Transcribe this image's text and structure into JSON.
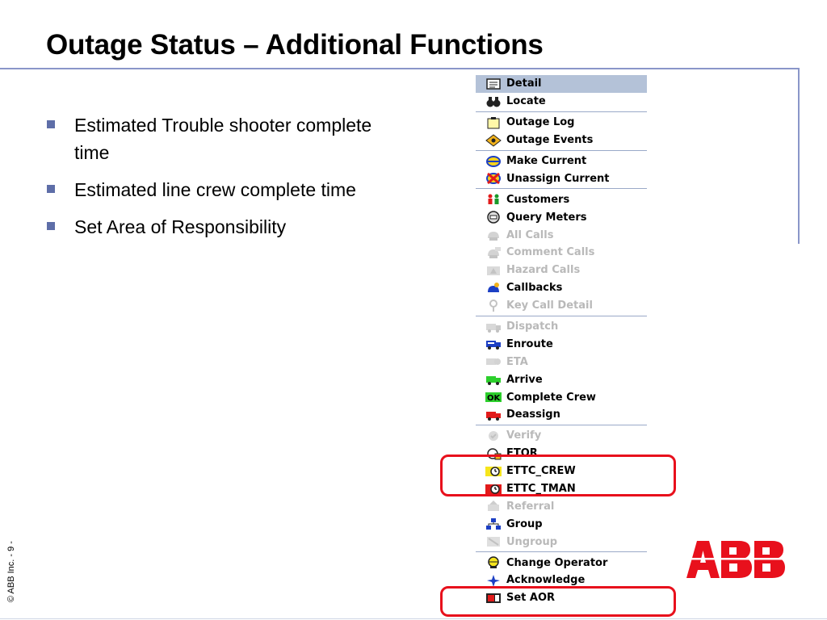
{
  "slide": {
    "title": "Outage Status – Additional Functions",
    "bullets": [
      "Estimated Trouble shooter complete time",
      "Estimated line crew complete time",
      "Set Area of Responsibility"
    ],
    "copyright": "© ABB Inc. - 9 -",
    "logo_text": "ABB",
    "logo_color": "#e8101c"
  },
  "menu": {
    "groups": [
      [
        {
          "label": "Detail",
          "icon": "detail-icon",
          "selected": true,
          "enabled": true
        },
        {
          "label": "Locate",
          "icon": "binoculars-icon",
          "enabled": true
        }
      ],
      [
        {
          "label": "Outage Log",
          "icon": "log-icon",
          "enabled": true
        },
        {
          "label": "Outage Events",
          "icon": "events-icon",
          "enabled": true
        }
      ],
      [
        {
          "label": "Make Current",
          "icon": "make-current-icon",
          "enabled": true
        },
        {
          "label": "Unassign Current",
          "icon": "unassign-icon",
          "enabled": true
        }
      ],
      [
        {
          "label": "Customers",
          "icon": "customers-icon",
          "enabled": true
        },
        {
          "label": "Query Meters",
          "icon": "meter-icon",
          "enabled": true
        },
        {
          "label": "All Calls",
          "icon": "phone-icon",
          "enabled": false
        },
        {
          "label": "Comment Calls",
          "icon": "phone-comment-icon",
          "enabled": false
        },
        {
          "label": "Hazard Calls",
          "icon": "phone-hazard-icon",
          "enabled": false
        },
        {
          "label": "Callbacks",
          "icon": "callback-icon",
          "enabled": true
        },
        {
          "label": "Key Call Detail",
          "icon": "key-icon",
          "enabled": false
        }
      ],
      [
        {
          "label": "Dispatch",
          "icon": "truck-icon",
          "enabled": false
        },
        {
          "label": "Enroute",
          "icon": "truck-blue-icon",
          "enabled": true
        },
        {
          "label": "ETA",
          "icon": "truck-clock-icon",
          "enabled": false
        },
        {
          "label": "Arrive",
          "icon": "truck-green-icon",
          "enabled": true
        },
        {
          "label": "Complete Crew",
          "icon": "ok-icon",
          "enabled": true
        },
        {
          "label": "Deassign",
          "icon": "truck-red-icon",
          "enabled": true
        }
      ],
      [
        {
          "label": "Verify",
          "icon": "verify-icon",
          "enabled": false
        },
        {
          "label": "ETOR",
          "icon": "etor-icon",
          "enabled": true
        },
        {
          "label": "ETTC_CREW",
          "icon": "clock-yellow-icon",
          "enabled": true
        },
        {
          "label": "ETTC_TMAN",
          "icon": "clock-red-icon",
          "enabled": true
        },
        {
          "label": "Referral",
          "icon": "referral-icon",
          "enabled": false
        },
        {
          "label": "Group",
          "icon": "group-icon",
          "enabled": true
        },
        {
          "label": "Ungroup",
          "icon": "ungroup-icon",
          "enabled": false
        }
      ],
      [
        {
          "label": "Change Operator",
          "icon": "operator-icon",
          "enabled": true
        },
        {
          "label": "Acknowledge",
          "icon": "acknowledge-icon",
          "enabled": true
        },
        {
          "label": "Set AOR",
          "icon": "aor-icon",
          "enabled": true
        }
      ]
    ]
  },
  "colors": {
    "highlight": "#e8101c",
    "bullet": "#5e6ea8",
    "rule": "#8a96c9",
    "selected_bg": "#b4c2d8",
    "disabled_text": "#b9b9b9"
  }
}
